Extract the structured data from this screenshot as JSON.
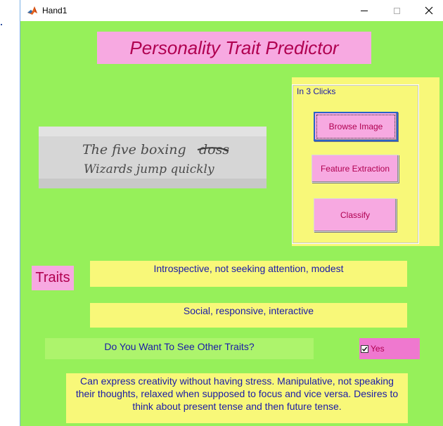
{
  "window": {
    "title": "Hand1",
    "icon": "matlab-icon"
  },
  "title_panel": {
    "text": "Personality Trait Predictor"
  },
  "handwriting_sample": {
    "line1": "The five boxing",
    "strike": "doss",
    "line2": "Wizards jump quickly"
  },
  "clicks_panel": {
    "legend": "In 3 Clicks",
    "browse_label": "Browse Image",
    "feature_label": "Feature Extraction",
    "classify_label": "Classify"
  },
  "traits": {
    "label": "Traits",
    "trait_1": "Introspective, not seeking attention, modest",
    "trait_2": "Social, responsive, interactive",
    "question": "Do You Want To See Other Traits?",
    "checkbox_label": "Yes",
    "checkbox_checked": true,
    "trait_3": "Can express creativity without having stress. Manipulative, not speaking their thoughts, relaxed when supposed to focus and vice versa. Desires to think about present tense and then future tense."
  },
  "colors": {
    "figure_background": "#96f05a",
    "pink_panel": "#f7a9e1",
    "yellow_panel": "#f8f879",
    "title_text": "#b00050",
    "body_text": "#1a1aa8"
  }
}
